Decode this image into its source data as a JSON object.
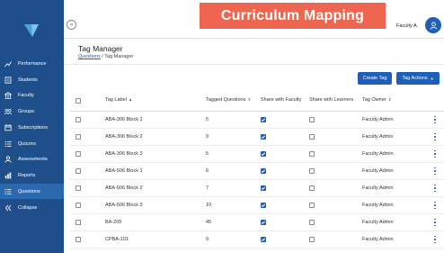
{
  "banner": {
    "title": "Curriculum Mapping"
  },
  "header": {
    "user_name": "Faculty A.",
    "collapse_toggle": "»"
  },
  "sidebar": {
    "items": [
      {
        "label": "Performance",
        "icon": "performance-chart-icon",
        "active": false
      },
      {
        "label": "Students",
        "icon": "students-icon",
        "active": false
      },
      {
        "label": "Faculty",
        "icon": "faculty-building-icon",
        "active": false
      },
      {
        "label": "Groups",
        "icon": "groups-icon",
        "active": false
      },
      {
        "label": "Subscriptions",
        "icon": "subscriptions-icon",
        "active": false
      },
      {
        "label": "Quizzes",
        "icon": "quizzes-list-icon",
        "active": false
      },
      {
        "label": "Assessments",
        "icon": "assessments-icon",
        "active": false
      },
      {
        "label": "Reports",
        "icon": "reports-icon",
        "active": false
      },
      {
        "label": "Questions",
        "icon": "questions-list-icon",
        "active": true
      },
      {
        "label": "Collapse",
        "icon": "collapse-double-chevron-icon",
        "active": false
      }
    ]
  },
  "page": {
    "title": "Tag Manager",
    "breadcrumb": {
      "link": "Questions",
      "separator": " / ",
      "current": "Tag Manager"
    }
  },
  "buttons": {
    "create_tag": "Create Tag",
    "tag_actions": "Tag Actions"
  },
  "table": {
    "columns": {
      "tag_label": "Tag Label",
      "tagged_questions": "Tagged Questions",
      "share_faculty": "Share with Faculty",
      "share_learners": "Share with Learners",
      "tag_owner": "Tag Owner"
    },
    "rows": [
      {
        "label": "ABA-306 Block 1",
        "tagged": "5",
        "faculty": true,
        "learners": false,
        "owner": "Faculty Admin"
      },
      {
        "label": "ABA-306 Block 2",
        "tagged": "9",
        "faculty": true,
        "learners": false,
        "owner": "Faculty Admin"
      },
      {
        "label": "ABA-306 Block 3",
        "tagged": "5",
        "faculty": true,
        "learners": false,
        "owner": "Faculty Admin"
      },
      {
        "label": "ABA-506 Block 1",
        "tagged": "6",
        "faculty": true,
        "learners": false,
        "owner": "Faculty Admin"
      },
      {
        "label": "ABA-506 Block 2",
        "tagged": "7",
        "faculty": true,
        "learners": false,
        "owner": "Faculty Admin"
      },
      {
        "label": "ABA-506 Block 3",
        "tagged": "10",
        "faculty": true,
        "learners": false,
        "owner": "Faculty Admin"
      },
      {
        "label": "BA-205",
        "tagged": "45",
        "faculty": true,
        "learners": false,
        "owner": "Faculty Admin"
      },
      {
        "label": "CPBA-101",
        "tagged": "9",
        "faculty": true,
        "learners": false,
        "owner": "Faculty Admin"
      }
    ]
  },
  "colors": {
    "sidebar_bg": "#1e4f8a",
    "sidebar_active": "#2c68ad",
    "primary": "#1f5fb6",
    "banner": "#ee6650"
  }
}
